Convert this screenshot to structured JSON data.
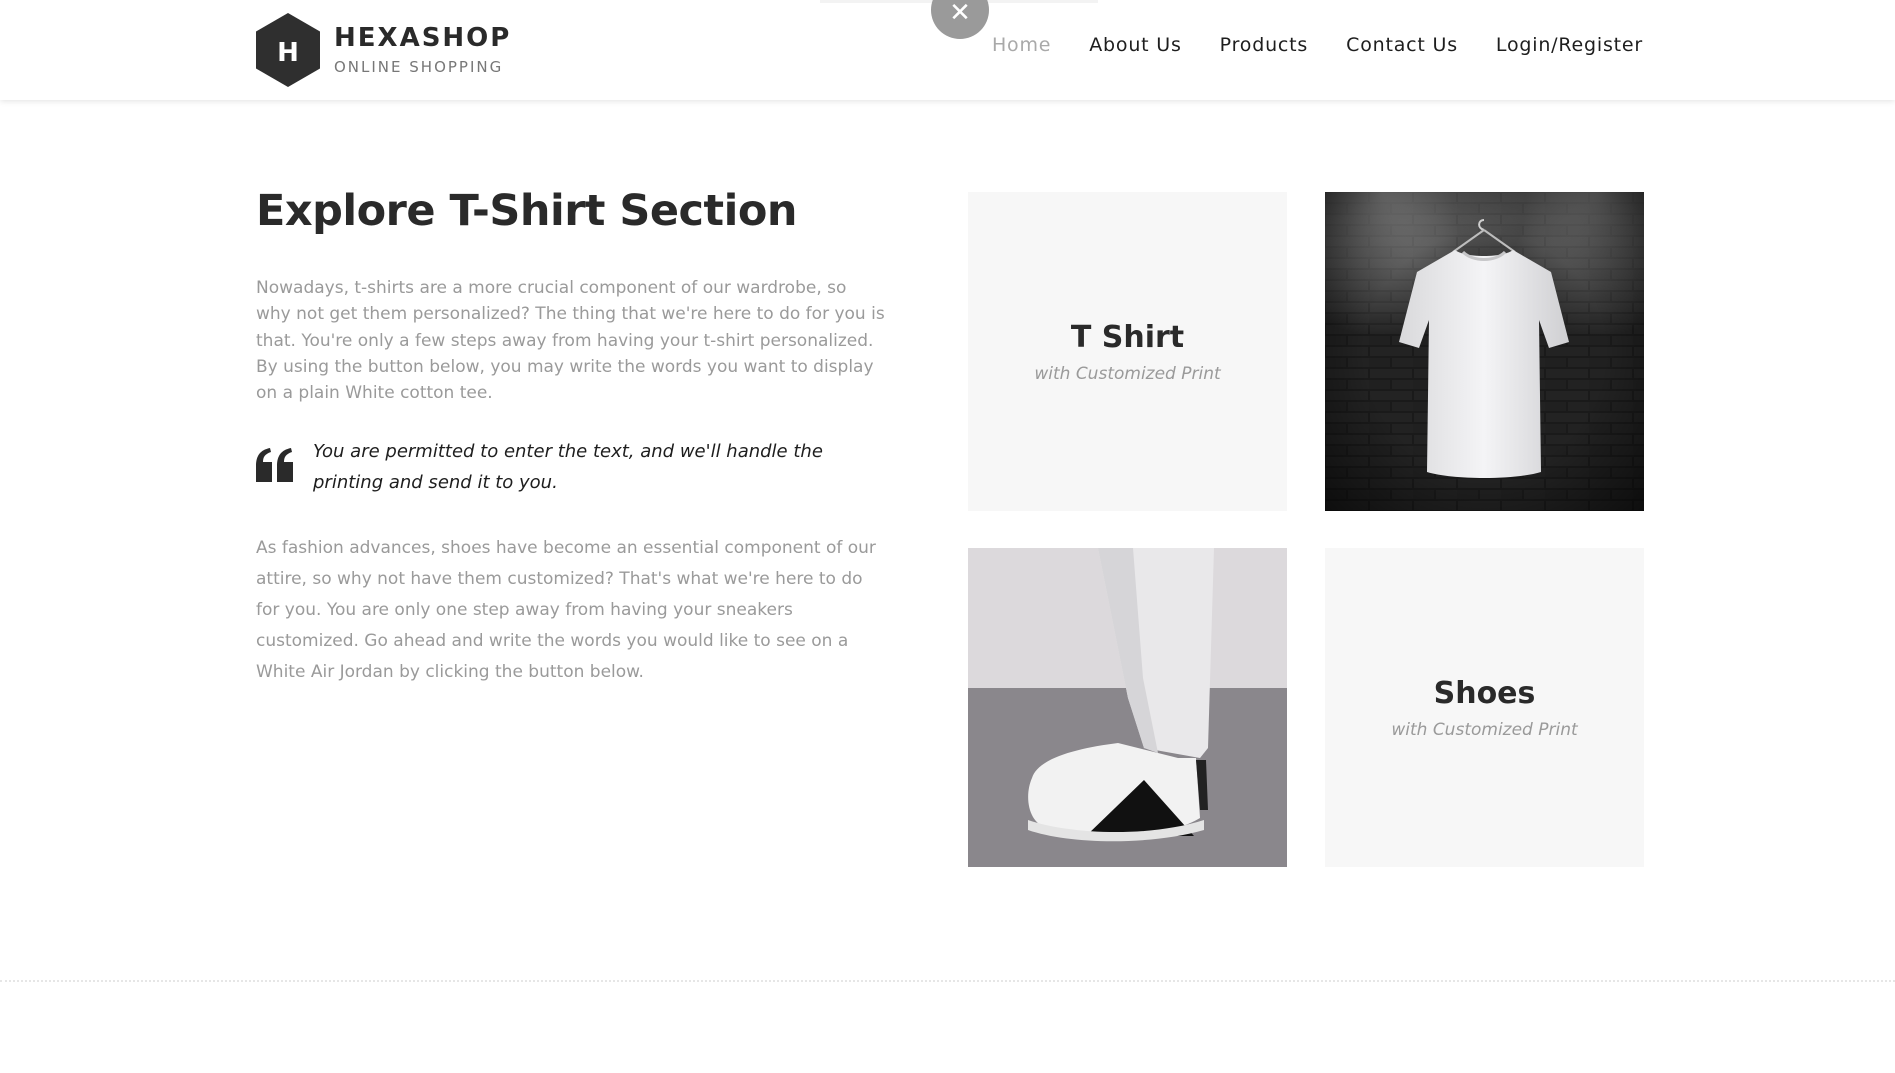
{
  "brand": {
    "title": "HEXASHOP",
    "subtitle": "ONLINE SHOPPING",
    "logo_letter": "H",
    "logo_color": "#2f2f2f"
  },
  "nav": {
    "items": [
      {
        "label": "Home",
        "active": true
      },
      {
        "label": "About Us",
        "active": false
      },
      {
        "label": "Products",
        "active": false
      },
      {
        "label": "Contact Us",
        "active": false
      },
      {
        "label": "Login/Register",
        "active": false
      }
    ]
  },
  "popup": {
    "close_icon": "close-icon",
    "close_glyph": "✕"
  },
  "main": {
    "title": "Explore T-Shirt Section",
    "paragraph_1": "Nowadays, t-shirts are a more crucial component of our wardrobe, so why not get them personalized? The thing that we're here to do for you is that. You're only a few steps away from having your t-shirt personalized. By using the button below, you may write the words you want to display on a plain White cotton tee.",
    "quote": "You are permitted to enter the text, and we'll handle the printing and send it to you.",
    "quote_icon": "quote-icon",
    "paragraph_2": "As fashion advances, shoes have become an essential component of our attire, so why not have them customized? That's what we're here to do for you. You are only one step away from having your sneakers customized. Go ahead and write the words you would like to see on a White Air Jordan by clicking the button below."
  },
  "tiles": [
    {
      "title": "T Shirt",
      "subtitle": "with Customized Print"
    },
    {
      "image": "white-tshirt-on-brick-wall"
    },
    {
      "image": "white-sneakers-photo"
    },
    {
      "title": "Shoes",
      "subtitle": "with Customized Print"
    }
  ],
  "colors": {
    "text_dark": "#2a2a2a",
    "text_muted": "#9a9a9a",
    "nav_active": "#a9a9a9",
    "tile_bg": "#f7f7f7"
  }
}
